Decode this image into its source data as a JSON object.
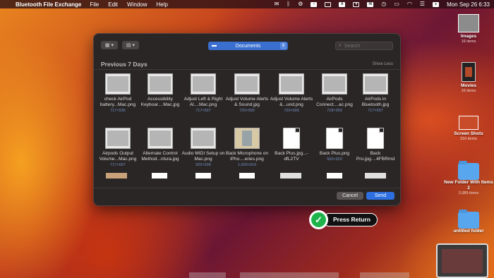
{
  "menubar": {
    "app_name": "Bluetooth File Exchange",
    "menus": [
      "File",
      "Edit",
      "Window",
      "Help"
    ],
    "keyboard_input": "IN",
    "clock": "Mon Sep 26  6:33"
  },
  "dialog": {
    "folder": "Documents",
    "search_placeholder": "Search",
    "section_title": "Previous 7 Days",
    "show_less": "Show Less",
    "cancel_label": "Cancel",
    "send_label": "Send",
    "files": [
      {
        "name": "check AirPod battery...Mac.png",
        "size": "717×536",
        "kind": "screenshot"
      },
      {
        "name": "Accessibility Keyboar....Mac.jpg",
        "size": "",
        "kind": "screenshot"
      },
      {
        "name": "Adjust Left & Right Al....Mac.png",
        "size": "717×697",
        "kind": "screenshot"
      },
      {
        "name": "Adjust Volume Alerts & Sound.jpg",
        "size": "720×699",
        "kind": "screenshot"
      },
      {
        "name": "Adjust Volume Alerts &...und.png",
        "size": "720×699",
        "kind": "screenshot"
      },
      {
        "name": "AirPods Connect....ac.png",
        "size": "718×369",
        "kind": "screenshot"
      },
      {
        "name": "AirPods in Bluetooth.jpg",
        "size": "717×697",
        "kind": "screenshot"
      },
      {
        "name": "Airpods Output Volume...Mac.png",
        "size": "717×697",
        "kind": "screenshot"
      },
      {
        "name": "Alternate Control Method...ntura.jpg",
        "size": "",
        "kind": "screenshot"
      },
      {
        "name": "Audio MIDI Setup on Mac.png",
        "size": "925×538",
        "kind": "screenshot"
      },
      {
        "name": "Back Microphone on iPho....eries.png",
        "size": "1,000×919",
        "kind": "photo"
      },
      {
        "name": "Back Plus.jpg...-dfL2TV",
        "size": "",
        "kind": "document"
      },
      {
        "name": "Back Plus.png",
        "size": "500×920",
        "kind": "document"
      },
      {
        "name": "Back Pro.jpg....4FBRmd",
        "size": "",
        "kind": "document"
      }
    ]
  },
  "desktop": [
    {
      "label": "Images",
      "count": "16 items",
      "kind": "stack"
    },
    {
      "label": "Movies",
      "count": "16 items",
      "kind": "video"
    },
    {
      "label": "Screen Shots",
      "count": "316 items",
      "kind": "shots"
    },
    {
      "label": "New Folder With Items 2",
      "count": "2,089 items",
      "kind": "folder"
    },
    {
      "label": "untitled folder",
      "count": "",
      "kind": "folder"
    }
  ],
  "overlay": {
    "press_return": "Press Return"
  }
}
